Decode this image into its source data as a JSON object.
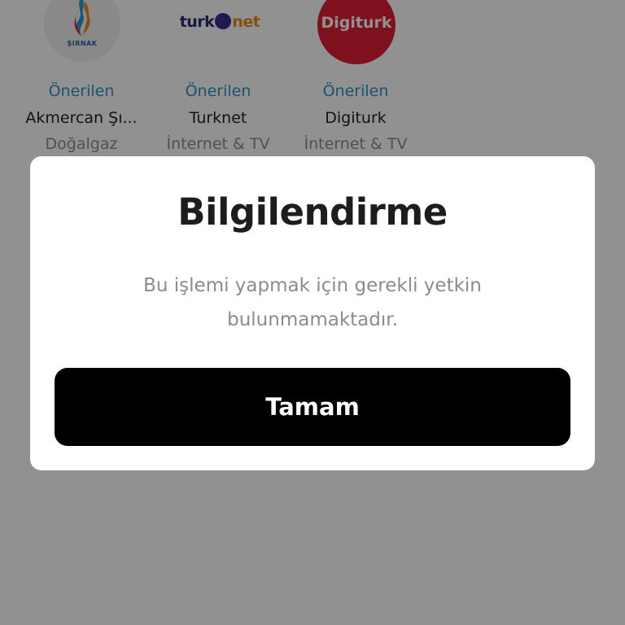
{
  "providers": [
    {
      "logo_text": "ŞIRNAK",
      "recommended": "Önerilen",
      "name": "Akmercan Şı...",
      "category": "Doğalgaz"
    },
    {
      "logo_text_main": "turk",
      "logo_text_accent": "net",
      "recommended": "Önerilen",
      "name": "Turknet",
      "category": "İnternet & TV"
    },
    {
      "logo_text": "Digiturk",
      "recommended": "Önerilen",
      "name": "Digiturk",
      "category": "İnternet & TV"
    }
  ],
  "dialog": {
    "title": "Bilgilendirme",
    "message": "Bu işlemi yapmak için gerekli yetkin bulunmamaktadır.",
    "button_label": "Tamam"
  },
  "colors": {
    "accent_link": "#2f95c9",
    "digiturk_brand": "#e01f37",
    "turknet_brand": "#2b2d77",
    "turknet_accent": "#f08a1c",
    "button_bg": "#000000"
  }
}
